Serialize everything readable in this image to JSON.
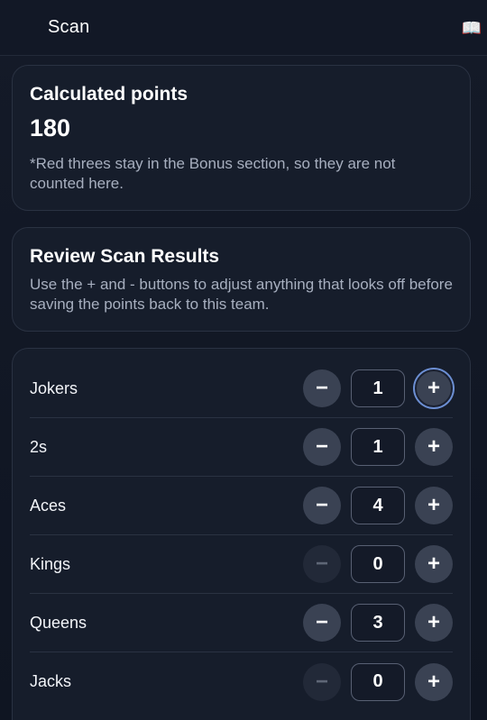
{
  "header": {
    "title": "Scan",
    "icon": "open-book-icon",
    "icon_glyph": "📖"
  },
  "points_card": {
    "title": "Calculated points",
    "value": "180",
    "note": "*Red threes stay in the Bonus section, so they are not counted here."
  },
  "review_card": {
    "title": "Review Scan Results",
    "description": "Use the + and - buttons to adjust anything that looks off before saving the points back to this team."
  },
  "counts": [
    {
      "label": "Jokers",
      "value": "1",
      "minus": "−",
      "plus": "+"
    },
    {
      "label": "2s",
      "value": "1",
      "minus": "−",
      "plus": "+"
    },
    {
      "label": "Aces",
      "value": "4",
      "minus": "−",
      "plus": "+"
    },
    {
      "label": "Kings",
      "value": "0",
      "minus": "−",
      "plus": "+"
    },
    {
      "label": "Queens",
      "value": "3",
      "minus": "−",
      "plus": "+"
    },
    {
      "label": "Jacks",
      "value": "0",
      "minus": "−",
      "plus": "+"
    }
  ]
}
